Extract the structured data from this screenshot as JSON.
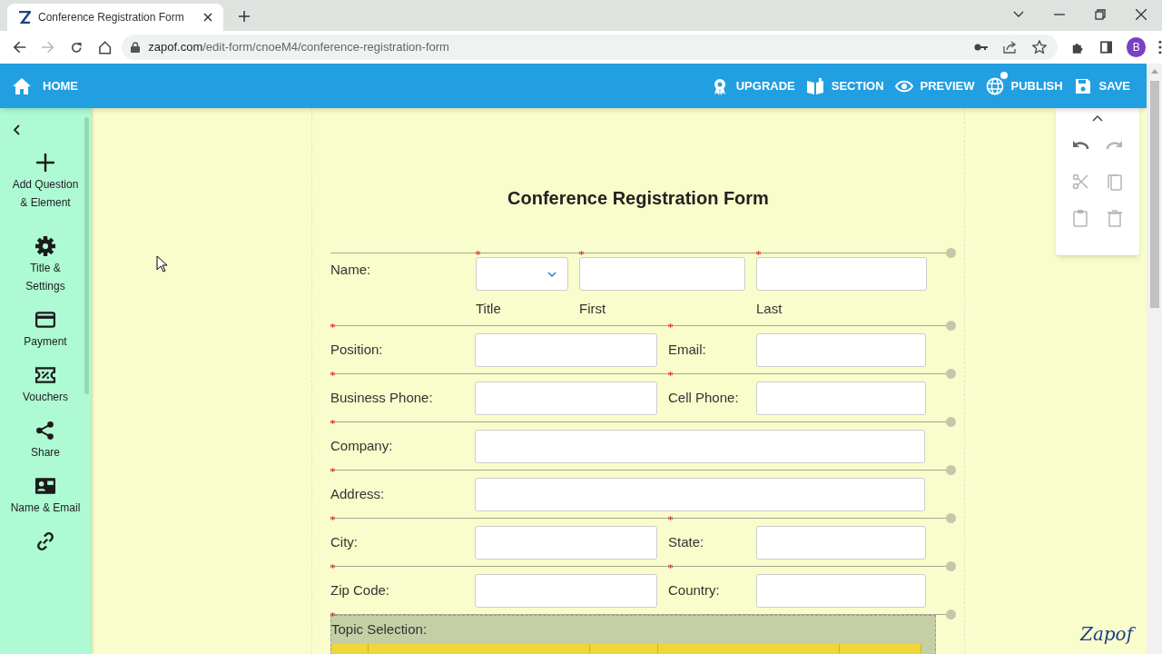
{
  "browser": {
    "tab_title": "Conference Registration Form",
    "url_host": "zapof.com",
    "url_path": "/edit-form/cnoeM4/conference-registration-form",
    "forward_disabled": true,
    "avatar": "B"
  },
  "header": {
    "home": "HOME",
    "actions": [
      {
        "kind": "upgrade",
        "label": "UPGRADE",
        "dot": false
      },
      {
        "kind": "section",
        "label": "SECTION",
        "dot": false
      },
      {
        "kind": "preview",
        "label": "PREVIEW",
        "dot": false
      },
      {
        "kind": "publish",
        "label": "PUBLISH",
        "dot": true
      },
      {
        "kind": "save",
        "label": "SAVE",
        "dot": false
      }
    ]
  },
  "sidebar": {
    "items": [
      {
        "kind": "add",
        "label": "Add Question\n& Element"
      },
      {
        "kind": "settings",
        "label": "Title &\nSettings"
      },
      {
        "kind": "payment",
        "label": "Payment"
      },
      {
        "kind": "vouchers",
        "label": "Vouchers"
      },
      {
        "kind": "share",
        "label": "Share"
      },
      {
        "kind": "contact",
        "label": "Name & Email"
      },
      {
        "kind": "link"
      }
    ]
  },
  "edit_tools": [
    {
      "kind": "undo",
      "disabled": false
    },
    {
      "kind": "redo",
      "disabled": true
    },
    {
      "kind": "cut",
      "disabled": true
    },
    {
      "kind": "copy",
      "disabled": true
    },
    {
      "kind": "paste",
      "disabled": true
    },
    {
      "kind": "delete",
      "disabled": true
    }
  ],
  "form": {
    "title": "Conference Registration Form",
    "rows": [
      {
        "kind": "name",
        "label": "Name:",
        "parts": [
          {
            "kind": "dropdown",
            "sublabel": "Title",
            "required": true
          },
          {
            "kind": "text",
            "sublabel": "First",
            "required": true
          },
          {
            "kind": "text",
            "sublabel": "Last",
            "required": true
          }
        ]
      },
      {
        "kind": "pair",
        "fields": [
          {
            "label": "Position:",
            "required": true
          },
          {
            "label": "Email:",
            "required": true
          }
        ]
      },
      {
        "kind": "pair",
        "fields": [
          {
            "label": "Business Phone:",
            "required": true
          },
          {
            "label": "Cell Phone:",
            "required": true
          }
        ]
      },
      {
        "kind": "single",
        "fields": [
          {
            "label": "Company:",
            "required": true
          }
        ]
      },
      {
        "kind": "single",
        "fields": [
          {
            "label": "Address:",
            "required": true
          }
        ]
      },
      {
        "kind": "pair",
        "fields": [
          {
            "label": "City:",
            "required": true
          },
          {
            "label": "State:",
            "required": true
          }
        ]
      },
      {
        "kind": "pair",
        "fields": [
          {
            "label": "Zip Code:",
            "required": true
          },
          {
            "label": "Country:",
            "required": true
          }
        ]
      },
      {
        "kind": "table",
        "label": "Topic Selection:",
        "required": true,
        "selected": true
      }
    ]
  },
  "logo": "Zapof"
}
